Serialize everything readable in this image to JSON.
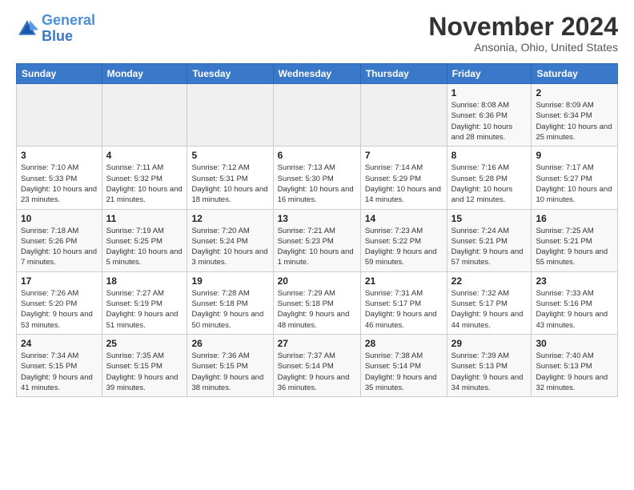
{
  "header": {
    "logo_line1": "General",
    "logo_line2": "Blue",
    "month": "November 2024",
    "location": "Ansonia, Ohio, United States"
  },
  "days_header": [
    "Sunday",
    "Monday",
    "Tuesday",
    "Wednesday",
    "Thursday",
    "Friday",
    "Saturday"
  ],
  "weeks": [
    [
      {
        "num": "",
        "info": ""
      },
      {
        "num": "",
        "info": ""
      },
      {
        "num": "",
        "info": ""
      },
      {
        "num": "",
        "info": ""
      },
      {
        "num": "",
        "info": ""
      },
      {
        "num": "1",
        "info": "Sunrise: 8:08 AM\nSunset: 6:36 PM\nDaylight: 10 hours and 28 minutes."
      },
      {
        "num": "2",
        "info": "Sunrise: 8:09 AM\nSunset: 6:34 PM\nDaylight: 10 hours and 25 minutes."
      }
    ],
    [
      {
        "num": "3",
        "info": "Sunrise: 7:10 AM\nSunset: 5:33 PM\nDaylight: 10 hours and 23 minutes."
      },
      {
        "num": "4",
        "info": "Sunrise: 7:11 AM\nSunset: 5:32 PM\nDaylight: 10 hours and 21 minutes."
      },
      {
        "num": "5",
        "info": "Sunrise: 7:12 AM\nSunset: 5:31 PM\nDaylight: 10 hours and 18 minutes."
      },
      {
        "num": "6",
        "info": "Sunrise: 7:13 AM\nSunset: 5:30 PM\nDaylight: 10 hours and 16 minutes."
      },
      {
        "num": "7",
        "info": "Sunrise: 7:14 AM\nSunset: 5:29 PM\nDaylight: 10 hours and 14 minutes."
      },
      {
        "num": "8",
        "info": "Sunrise: 7:16 AM\nSunset: 5:28 PM\nDaylight: 10 hours and 12 minutes."
      },
      {
        "num": "9",
        "info": "Sunrise: 7:17 AM\nSunset: 5:27 PM\nDaylight: 10 hours and 10 minutes."
      }
    ],
    [
      {
        "num": "10",
        "info": "Sunrise: 7:18 AM\nSunset: 5:26 PM\nDaylight: 10 hours and 7 minutes."
      },
      {
        "num": "11",
        "info": "Sunrise: 7:19 AM\nSunset: 5:25 PM\nDaylight: 10 hours and 5 minutes."
      },
      {
        "num": "12",
        "info": "Sunrise: 7:20 AM\nSunset: 5:24 PM\nDaylight: 10 hours and 3 minutes."
      },
      {
        "num": "13",
        "info": "Sunrise: 7:21 AM\nSunset: 5:23 PM\nDaylight: 10 hours and 1 minute."
      },
      {
        "num": "14",
        "info": "Sunrise: 7:23 AM\nSunset: 5:22 PM\nDaylight: 9 hours and 59 minutes."
      },
      {
        "num": "15",
        "info": "Sunrise: 7:24 AM\nSunset: 5:21 PM\nDaylight: 9 hours and 57 minutes."
      },
      {
        "num": "16",
        "info": "Sunrise: 7:25 AM\nSunset: 5:21 PM\nDaylight: 9 hours and 55 minutes."
      }
    ],
    [
      {
        "num": "17",
        "info": "Sunrise: 7:26 AM\nSunset: 5:20 PM\nDaylight: 9 hours and 53 minutes."
      },
      {
        "num": "18",
        "info": "Sunrise: 7:27 AM\nSunset: 5:19 PM\nDaylight: 9 hours and 51 minutes."
      },
      {
        "num": "19",
        "info": "Sunrise: 7:28 AM\nSunset: 5:18 PM\nDaylight: 9 hours and 50 minutes."
      },
      {
        "num": "20",
        "info": "Sunrise: 7:29 AM\nSunset: 5:18 PM\nDaylight: 9 hours and 48 minutes."
      },
      {
        "num": "21",
        "info": "Sunrise: 7:31 AM\nSunset: 5:17 PM\nDaylight: 9 hours and 46 minutes."
      },
      {
        "num": "22",
        "info": "Sunrise: 7:32 AM\nSunset: 5:17 PM\nDaylight: 9 hours and 44 minutes."
      },
      {
        "num": "23",
        "info": "Sunrise: 7:33 AM\nSunset: 5:16 PM\nDaylight: 9 hours and 43 minutes."
      }
    ],
    [
      {
        "num": "24",
        "info": "Sunrise: 7:34 AM\nSunset: 5:15 PM\nDaylight: 9 hours and 41 minutes."
      },
      {
        "num": "25",
        "info": "Sunrise: 7:35 AM\nSunset: 5:15 PM\nDaylight: 9 hours and 39 minutes."
      },
      {
        "num": "26",
        "info": "Sunrise: 7:36 AM\nSunset: 5:15 PM\nDaylight: 9 hours and 38 minutes."
      },
      {
        "num": "27",
        "info": "Sunrise: 7:37 AM\nSunset: 5:14 PM\nDaylight: 9 hours and 36 minutes."
      },
      {
        "num": "28",
        "info": "Sunrise: 7:38 AM\nSunset: 5:14 PM\nDaylight: 9 hours and 35 minutes."
      },
      {
        "num": "29",
        "info": "Sunrise: 7:39 AM\nSunset: 5:13 PM\nDaylight: 9 hours and 34 minutes."
      },
      {
        "num": "30",
        "info": "Sunrise: 7:40 AM\nSunset: 5:13 PM\nDaylight: 9 hours and 32 minutes."
      }
    ]
  ]
}
